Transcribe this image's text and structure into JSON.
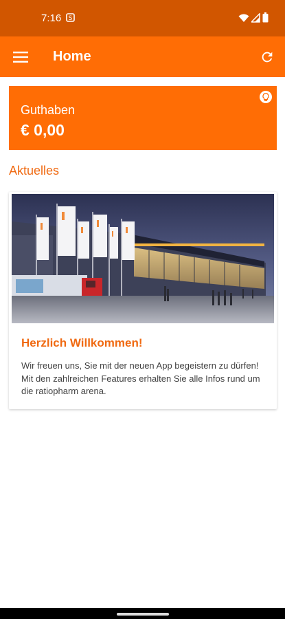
{
  "status_bar": {
    "time": "7:16",
    "icons": [
      "sim-icon",
      "wifi-icon",
      "signal-icon",
      "battery-icon"
    ]
  },
  "app_bar": {
    "title": "Home",
    "menu_icon": "hamburger-menu-icon",
    "refresh_icon": "refresh-icon"
  },
  "balance": {
    "label": "Guthaben",
    "value": "€ 0,00",
    "info_icon": "lightbulb-icon"
  },
  "news": {
    "section_title": "Aktuelles",
    "items": [
      {
        "title": "Herzlich Willkommen!",
        "text": "Wir freuen uns, Sie mit der neuen App begeistern zu dürfen! Mit den zahlreichen Features erhalten Sie alle Infos rund um die ratiopharm arena.",
        "image": "arena-exterior-photo"
      }
    ]
  },
  "colors": {
    "status_bar": "#d15600",
    "primary": "#ff6d05",
    "accent_text": "#f06a12",
    "body_text": "#424242"
  }
}
